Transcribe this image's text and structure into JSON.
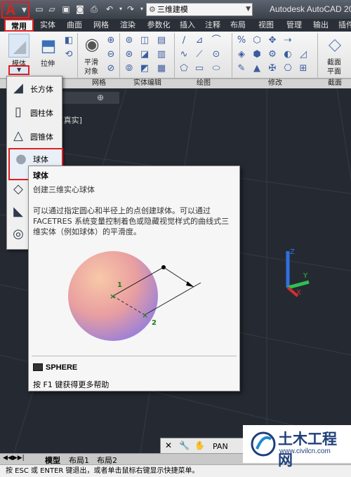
{
  "titlebar": {
    "workspace": "三维建模",
    "app_title": "Autodesk AutoCAD 20"
  },
  "tabs": [
    "常用",
    "实体",
    "曲面",
    "网格",
    "渲染",
    "参数化",
    "插入",
    "注释",
    "布局",
    "视图",
    "管理",
    "输出",
    "插件"
  ],
  "active_tab": "常用",
  "ribbon": {
    "modeling_btn": "长方体",
    "modeling_label": "模体",
    "extrude_label": "拉伸",
    "smooth_label_1": "平滑",
    "smooth_label_2": "对象",
    "section_label_1": "截面",
    "section_label_2": "平面",
    "panels": {
      "mesh": "网格",
      "solid_edit": "实体编辑",
      "draw": "绘图",
      "modify": "修改",
      "section": "截面"
    }
  },
  "viewport_label": "][真实]",
  "dropdown": {
    "items": [
      "长方体",
      "圆柱体",
      "圆锥体",
      "球体",
      "",
      "",
      ""
    ]
  },
  "tooltip": {
    "title": "球体",
    "subtitle": "创建三维实心球体",
    "description": "可以通过指定圆心和半径上的点创建球体。可以通过 FACETRES 系统变量控制着色或隐藏视觉样式的曲线式三维实体（例如球体）的平滑度。",
    "marker1": "1",
    "marker2": "2",
    "command": "SPHERE",
    "help": "按 F1 键获得更多帮助"
  },
  "command_bar": {
    "text": "PAN"
  },
  "layout_tabs": [
    "模型",
    "布局1",
    "布局2"
  ],
  "status_bar": "按 ESC 或 ENTER 键退出，或者单击鼠标右键显示快捷菜单。",
  "watermark": {
    "title": "土木工程网",
    "url": "www.civilcn.com"
  },
  "colors": {
    "accent_red": "#e02020",
    "axis_x": "#d03030",
    "axis_y": "#30c050",
    "axis_z": "#3070e0"
  }
}
